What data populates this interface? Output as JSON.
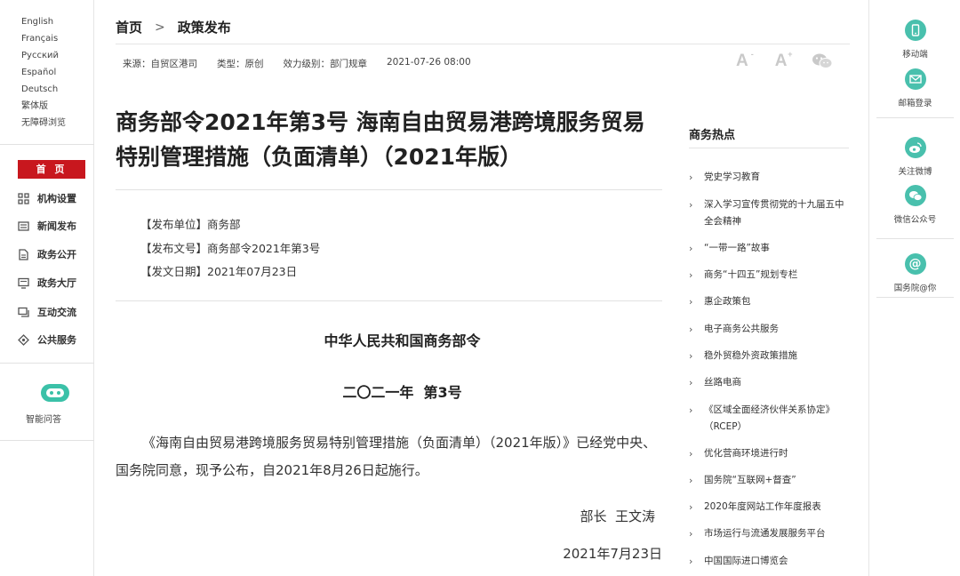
{
  "languages": [
    "English",
    "Français",
    "Русский",
    "Español",
    "Deutsch",
    "繁体版",
    "无障碍浏览"
  ],
  "left_nav": {
    "home": "首 页",
    "items": [
      {
        "label": "机构设置",
        "icon": "org-chart-icon"
      },
      {
        "label": "新闻发布",
        "icon": "newspaper-icon"
      },
      {
        "label": "政务公开",
        "icon": "document-icon"
      },
      {
        "label": "政务大厅",
        "icon": "monitor-icon"
      },
      {
        "label": "互动交流",
        "icon": "chat-icon"
      },
      {
        "label": "公共服务",
        "icon": "service-icon"
      }
    ],
    "assistant": {
      "label": "智能问答",
      "icon": "robot-icon"
    }
  },
  "breadcrumb": {
    "home": "首页",
    "separator": ">",
    "current": "政策发布"
  },
  "meta": {
    "source": "来源：自贸区港司",
    "type": "类型：原创",
    "level": "效力级别：部门规章",
    "datetime": "2021-07-26 08:00"
  },
  "tools": {
    "font_large": "A",
    "font_small": "A",
    "plus": "+",
    "minus": "-"
  },
  "article": {
    "title": "商务部令2021年第3号 海南自由贸易港跨境服务贸易特别管理措施（负面清单）（2021年版）",
    "issuer": "【发布单位】商务部",
    "doc_no": "【发布文号】商务部令2021年第3号",
    "issue_date": "【发文日期】2021年07月23日",
    "heading1": "中华人民共和国商务部令",
    "heading2": "二〇二一年  第3号",
    "body": "《海南自由贸易港跨境服务贸易特别管理措施（负面清单）（2021年版）》已经党中央、国务院同意，现予公布，自2021年8月26日起施行。",
    "signature": "部长  王文涛",
    "sign_date": "2021年7月23日"
  },
  "hot": {
    "title": "商务热点",
    "items": [
      "党史学习教育",
      "深入学习宣传贯彻党的十九届五中全会精神",
      "“一带一路”故事",
      "商务“十四五”规划专栏",
      "惠企政策包",
      "电子商务公共服务",
      "稳外贸稳外资政策措施",
      "丝路电商",
      "《区域全面经济伙伴关系协定》（RCEP）",
      "优化营商环境进行时",
      "国务院“互联网+督查”",
      "2020年度网站工作年度报表",
      "市场运行与流通发展服务平台",
      "中国国际进口博览会"
    ]
  },
  "share": [
    {
      "label": "移动端",
      "icon": "mobile-icon"
    },
    {
      "label": "邮箱登录",
      "icon": "mail-icon"
    },
    {
      "label": "关注微博",
      "icon": "weibo-icon"
    },
    {
      "label": "微信公众号",
      "icon": "wechat-icon"
    },
    {
      "label": "国务院@你",
      "icon": "at-icon"
    }
  ],
  "colors": {
    "accent_red": "#c8171e",
    "teal": "#49c0ad",
    "robot_green": "#3bc1a8"
  }
}
